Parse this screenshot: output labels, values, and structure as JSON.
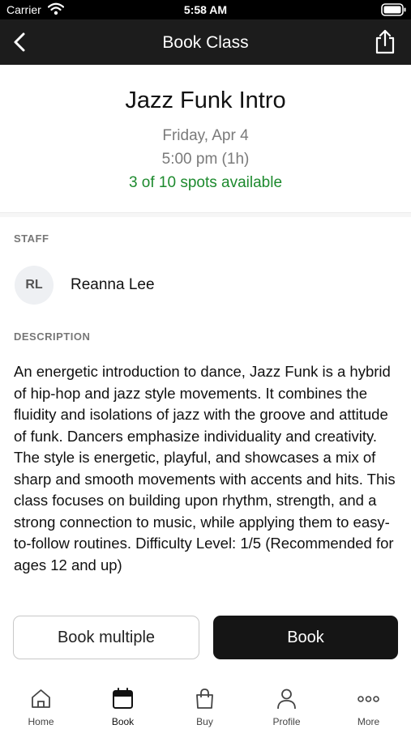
{
  "status_bar": {
    "carrier": "Carrier",
    "time": "5:58 AM"
  },
  "nav": {
    "title": "Book Class"
  },
  "class_info": {
    "name": "Jazz Funk Intro",
    "date": "Friday, Apr 4",
    "time": "5:00 pm (1h)",
    "availability": "3 of 10 spots available"
  },
  "staff": {
    "label": "STAFF",
    "initials": "RL",
    "name": "Reanna Lee"
  },
  "description": {
    "label": "DESCRIPTION",
    "text": "An energetic introduction to dance, Jazz Funk is a hybrid of hip-hop and jazz style movements. It combines the fluidity and isolations of jazz with the groove and attitude of funk. Dancers emphasize individuality and creativity. The style is energetic, playful, and showcases a mix of sharp and smooth movements with accents and hits. This class focuses on building upon rhythm, strength, and a strong connection to music, while applying them to easy-to-follow routines.    Difficulty Level: 1/5 (Recommended for ages 12 and up)"
  },
  "actions": {
    "book_multiple": "Book multiple",
    "book": "Book"
  },
  "tabs": [
    {
      "label": "Home",
      "icon": "home-icon"
    },
    {
      "label": "Book",
      "icon": "calendar-icon",
      "active": true
    },
    {
      "label": "Buy",
      "icon": "shopping-bag-icon"
    },
    {
      "label": "Profile",
      "icon": "person-icon"
    },
    {
      "label": "More",
      "icon": "more-dots-icon"
    }
  ],
  "colors": {
    "nav_bg": "#1c1c1c",
    "availability": "#1d8a2e",
    "primary_button": "#151515"
  }
}
